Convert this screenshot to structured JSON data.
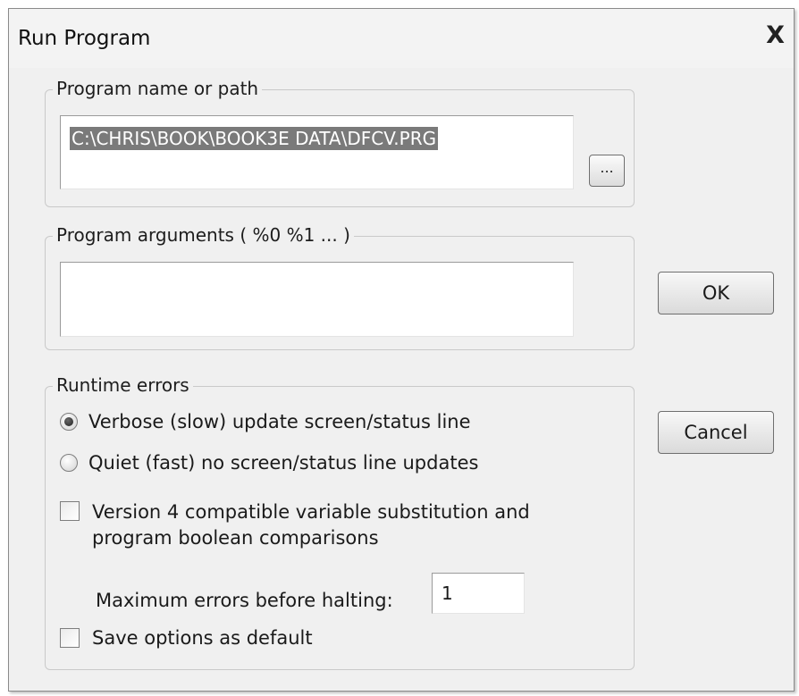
{
  "window": {
    "title": "Run Program",
    "close_glyph": "X"
  },
  "program_group": {
    "legend": "Program name or path",
    "path_value": "C:\\CHRIS\\BOOK\\BOOK3E DATA\\DFCV.PRG",
    "browse_label": "..."
  },
  "arguments_group": {
    "legend": "Program arguments ( %0  %1 ... )",
    "value": ""
  },
  "errors_group": {
    "legend": "Runtime errors",
    "radio_verbose": "Verbose (slow) update screen/status line",
    "radio_quiet": "Quiet (fast) no screen/status line updates",
    "selected_radio": "verbose",
    "version4_checkbox_label": "Version 4 compatible variable substitution and program boolean comparisons",
    "version4_checked": false,
    "max_errors_label": "Maximum errors before halting:",
    "max_errors_value": "1",
    "save_default_label": "Save options as default",
    "save_default_checked": false
  },
  "buttons": {
    "ok": "OK",
    "cancel": "Cancel"
  },
  "icons": {
    "close": "close-icon",
    "browse": "ellipsis-browse-icon"
  }
}
